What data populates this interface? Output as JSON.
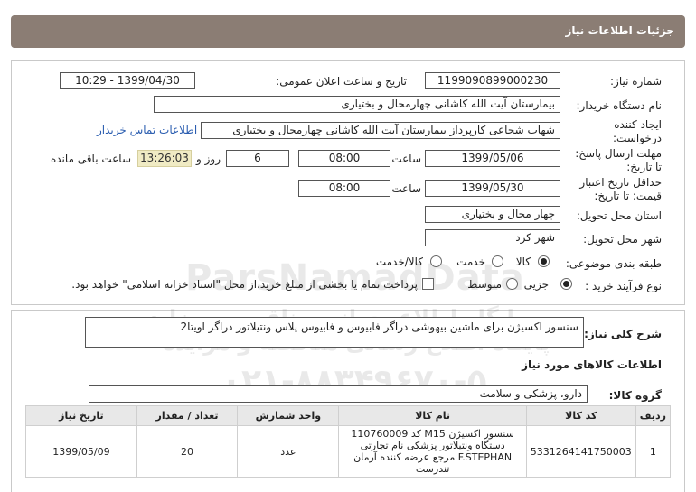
{
  "header": {
    "title": "جزئیات اطلاعات نیاز"
  },
  "form": {
    "need_number_label": "شماره نیاز:",
    "need_number": "1199090899000230",
    "announce_label": "تاریخ و ساعت اعلان عمومی:",
    "announce_value": "1399/04/30 - 10:29",
    "buyer_org_label": "نام دستگاه خریدار:",
    "buyer_org": "بیمارستان آیت الله کاشانی چهارمحال و بختیاری",
    "creator_label_1": "ایجاد کننده",
    "creator_label_2": "درخواست:",
    "creator": "شهاب شجاعی کارپرداز بیمارستان آیت الله کاشانی چهارمحال و بختیاری",
    "contact_link": "اطلاعات تماس خریدار",
    "deadline_label_1": "مهلت ارسال پاسخ:",
    "deadline_label_2": "تا تاریخ:",
    "deadline_date": "1399/05/06",
    "time_label": "ساعت",
    "deadline_time": "08:00",
    "days_value": "6",
    "days_label": "روز و",
    "remaining_time": "13:26:03",
    "remaining_label": "ساعت باقی مانده",
    "validity_label_1": "حداقل تاریخ اعتبار",
    "validity_label_2": "قیمت: تا تاریخ:",
    "validity_date": "1399/05/30",
    "validity_time": "08:00",
    "province_label": "استان محل تحویل:",
    "province": "چهار محال و بختیاری",
    "city_label": "شهر محل تحویل:",
    "city": "شهر کرد",
    "category_label": "طبقه بندی موضوعی:",
    "category_options": [
      "کالا",
      "خدمت",
      "کالا/خدمت"
    ],
    "category_selected": "کالا",
    "process_label": "نوع فرآیند خرید :",
    "process_options": [
      "جزیی",
      "متوسط"
    ],
    "process_selected": "جزیی",
    "treasury_note": "پرداخت تمام یا بخشی از مبلغ خرید،از محل \"اسناد خزانه اسلامی\" خواهد بود."
  },
  "description": {
    "label": "شرح کلی نیاز:",
    "text": "سنسور اکسیژن برای ماشین بیهوشی دراگر فابیوس و فابیوس پلاس ونتیلاتور دراگر اویتا2"
  },
  "goods": {
    "section_title": "اطلاعات کالاهای مورد نیاز",
    "group_label": "گروه کالا:",
    "group_value": "دارو، پزشکی و سلامت",
    "columns": [
      "ردیف",
      "کد کالا",
      "نام کالا",
      "واحد شمارش",
      "تعداد / مقدار",
      "تاریخ نیاز"
    ],
    "rows": [
      {
        "row": "1",
        "code": "5331264141750003",
        "name": "سنسور اکسیژن M15 کد 110760009 دستگاه ونتیلاتور پزشکی نام تجارتی F.STEPHAN مرجع عرضه کننده آرمان تندرست",
        "unit": "عدد",
        "qty": "20",
        "date": "1399/05/09"
      }
    ]
  },
  "watermark": {
    "brand": "ParsNamadData",
    "line1": "پایگاه اطلاع رسانی مناقصه و مزایده",
    "line2": "پایگاه اطلاع رسانی مناقصه و مزایده",
    "phone": "۰۲۱-۸۸۳۴۹۶۷۰-۵"
  }
}
